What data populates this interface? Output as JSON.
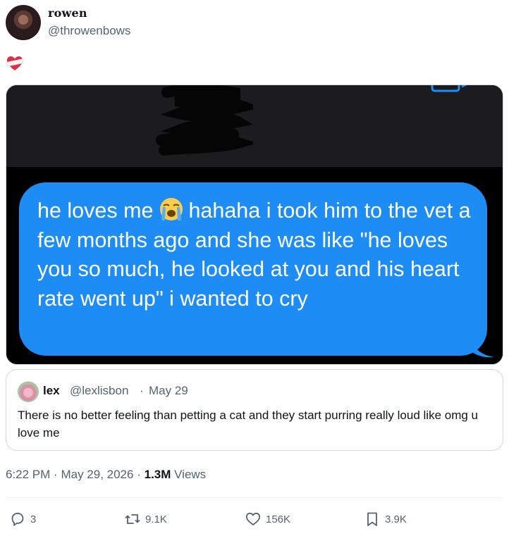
{
  "author": {
    "display_name": "rowen",
    "handle": "@throwenbows"
  },
  "tweet": {
    "emoji_icon": "heart-emoji"
  },
  "media": {
    "message_text_part1": "he loves me",
    "message_text_part2": "hahaha i took him to the vet a few months ago and she was like \"he loves you so much, he looked at you and his heart rate went up\" i wanted to cry",
    "bubble_color": "#1e8cf5"
  },
  "quote": {
    "name": "lex",
    "handle": "@lexlisbon",
    "separator": "·",
    "date": "May 29",
    "text": "There is no better feeling than petting a cat and they start purring really loud like omg u love me"
  },
  "meta": {
    "time": "6:22 PM",
    "separator": "·",
    "date": "May 29, 2026",
    "views_count": "1.3M",
    "views_label": "Views"
  },
  "actions": {
    "replies": "3",
    "reposts": "9.1K",
    "likes": "156K",
    "bookmarks": "3.9K"
  },
  "colors": {
    "text_primary": "#0f1419",
    "text_secondary": "#536471",
    "border": "#cfd9de"
  }
}
